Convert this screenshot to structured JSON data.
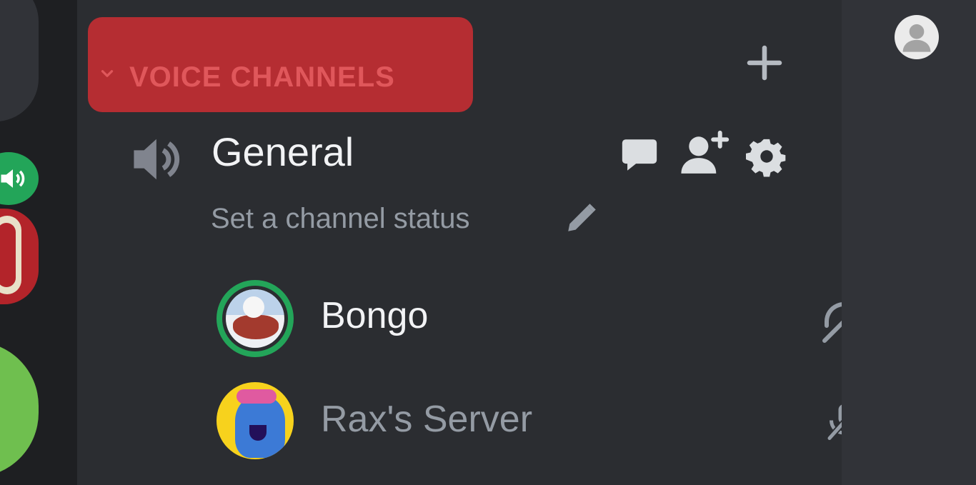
{
  "category": {
    "label": "VOICE CHANNELS"
  },
  "voice_channel": {
    "name": "General",
    "status_placeholder": "Set a channel status"
  },
  "users": [
    {
      "name": "Bongo",
      "speaking": true,
      "state_icon": "headphones-deafened-icon"
    },
    {
      "name": "Rax's Server",
      "speaking": false,
      "state_icon": "microphone-muted-icon"
    }
  ],
  "colors": {
    "highlight": "#b52d32",
    "speaking_ring": "#23a559",
    "channel_bg": "#2b2d31",
    "rail_bg": "#1e1f22"
  }
}
